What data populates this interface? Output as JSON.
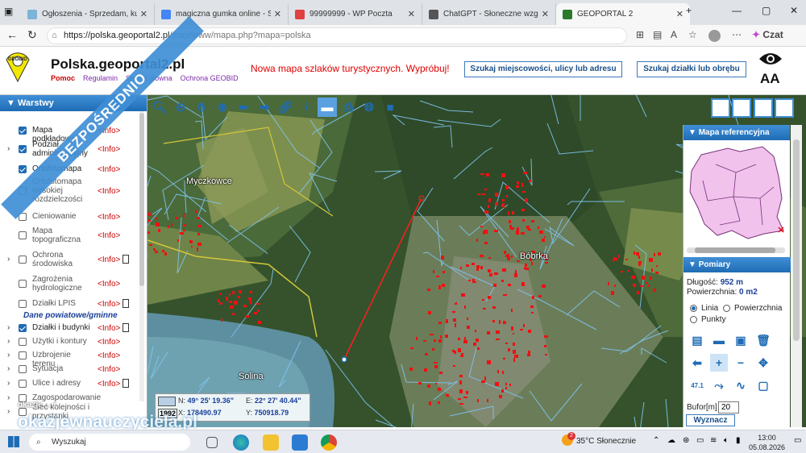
{
  "tabs": [
    {
      "title": "Ogłoszenia - Sprzedam, kupię",
      "color": "#7cb4d8"
    },
    {
      "title": "magiczna gumka online - Szuk",
      "color": "#4285f4"
    },
    {
      "title": "99999999 - WP Poczta",
      "color": "#e04040"
    },
    {
      "title": "ChatGPT - Słoneczne wzgórze",
      "color": "#555555"
    },
    {
      "title": "GEOPORTAL 2",
      "color": "#2a7a2a"
    }
  ],
  "browser": {
    "url_host": "https://polska.geoportal2.pl",
    "url_path": "/map/www/mapa.php?mapa=polska",
    "copilot": "Czat"
  },
  "site": {
    "title": "Polska.geoportal2.pl",
    "links": [
      "Pomoc",
      "Regulamin",
      "Strona główna",
      "Ochrona GEOBID"
    ],
    "promo": "Nowa mapa szlaków turystycznych. Wypróbuj!",
    "btn_search_place": "Szukaj miejscowości, ulicy lub adresu",
    "btn_search_parcel": "Szukaj działki lub obrębu",
    "font_size_label": "AA",
    "logo_text": "GEOBID"
  },
  "ribbon": "BEZPOŚREDNIO",
  "layers_panel": {
    "title": "Warstwy",
    "section_local": "Dane powiatowe/gminne",
    "items": [
      {
        "label": "Mapa podkładowa",
        "info": "<Info>",
        "checked": true
      },
      {
        "label": "Podział administracyjny",
        "info": "<Info>",
        "checked": true
      },
      {
        "label": "Ortofotomapa",
        "info": "<Info>",
        "checked": true
      },
      {
        "label": "Ortofotomapa wysokiej rozdzielczości",
        "info": "<Info>",
        "checked": false
      },
      {
        "label": "Cieniowanie",
        "info": "<Info>",
        "checked": false
      },
      {
        "label": "Mapa topograficzna",
        "info": "<Info>",
        "checked": false
      },
      {
        "label": "Ochrona środowiska",
        "info": "<Info>",
        "checked": false
      },
      {
        "label": "Zagrożenia hydrologiczne",
        "info": "<Info>",
        "checked": false
      },
      {
        "label": "Działki LPIS",
        "info": "<Info>",
        "checked": false
      },
      {
        "label": "Działki i budynki",
        "info": "<Info>",
        "checked": true
      },
      {
        "label": "Użytki i kontury",
        "info": "<Info>",
        "checked": false
      },
      {
        "label": "Uzbrojenie terenu",
        "info": "<Info>",
        "checked": false
      },
      {
        "label": "Sytuacja",
        "info": "<Info>",
        "checked": false
      },
      {
        "label": "Ulice i adresy",
        "info": "<Info>",
        "checked": false
      },
      {
        "label": "Zagospodarowanie",
        "info": "",
        "checked": false
      },
      {
        "label": "Sieć kolejności i przystanki",
        "info": "",
        "checked": false
      }
    ]
  },
  "map": {
    "places": [
      "Myczkowce",
      "Bóbrka",
      "Solina"
    ]
  },
  "coords": {
    "n_label": "N:",
    "n": "49° 25' 19.36\"",
    "e_label": "E:",
    "e": "22° 27' 40.44\"",
    "sys": "1992",
    "x_label": "X:",
    "x": "178490.97",
    "y_label": "Y:",
    "y": "750918.79"
  },
  "reference_map": {
    "title": "Mapa referencyjna"
  },
  "measure": {
    "title": "Pomiary",
    "length_label": "Długość:",
    "length": "952 m",
    "area_label": "Powierzchnia:",
    "area": "0 m2",
    "opt_line": "Linia",
    "opt_area": "Powierzchnia",
    "opt_points": "Punkty",
    "buffer_label": "Bufor[m]",
    "buffer": "20",
    "compute": "Wyznacz",
    "scale_hint": "47.1"
  },
  "watermark": {
    "main": "okazjewnauczyciela.pl",
    "small": "okazje ... i"
  },
  "taskbar": {
    "search": "Wyszukaj",
    "weather": "35°C  Słonecznie",
    "badge": "2",
    "time": "13:00",
    "date": "05.08.2026"
  }
}
